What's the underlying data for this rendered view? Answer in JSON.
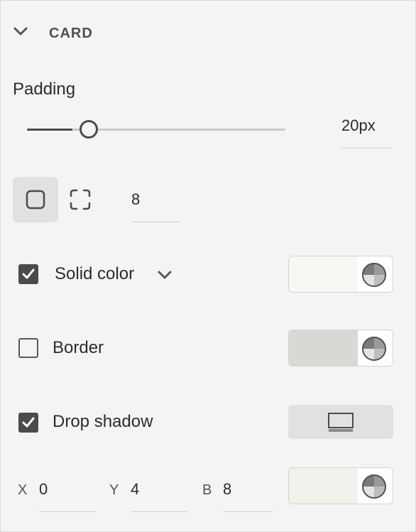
{
  "section": {
    "title": "CARD"
  },
  "padding": {
    "label": "Padding",
    "value": "20px",
    "slider_fraction": 0.2
  },
  "corner_radius": {
    "value": "8"
  },
  "fill": {
    "label": "Solid color",
    "checked": true,
    "swatch_color": "#f8f7f3"
  },
  "border": {
    "label": "Border",
    "checked": false,
    "swatch_color": "#d9d8d4"
  },
  "drop_shadow": {
    "label": "Drop shadow",
    "checked": true,
    "swatch_color": "#f2f1ec",
    "x_label": "X",
    "x_value": "0",
    "y_label": "Y",
    "y_value": "4",
    "b_label": "B",
    "b_value": "8"
  },
  "colors": {
    "panel_bg": "#f4f4f4",
    "accent": "#4b4b4b"
  },
  "icons": {
    "collapse": "chevron-down-icon",
    "corner_uniform": "rounded-square-icon",
    "corner_individual": "corner-dashed-icon",
    "fill_type": "chevron-down-icon",
    "color_picker": "color-wheel-icon",
    "shadow_preview": "monitor-shadow-icon"
  }
}
